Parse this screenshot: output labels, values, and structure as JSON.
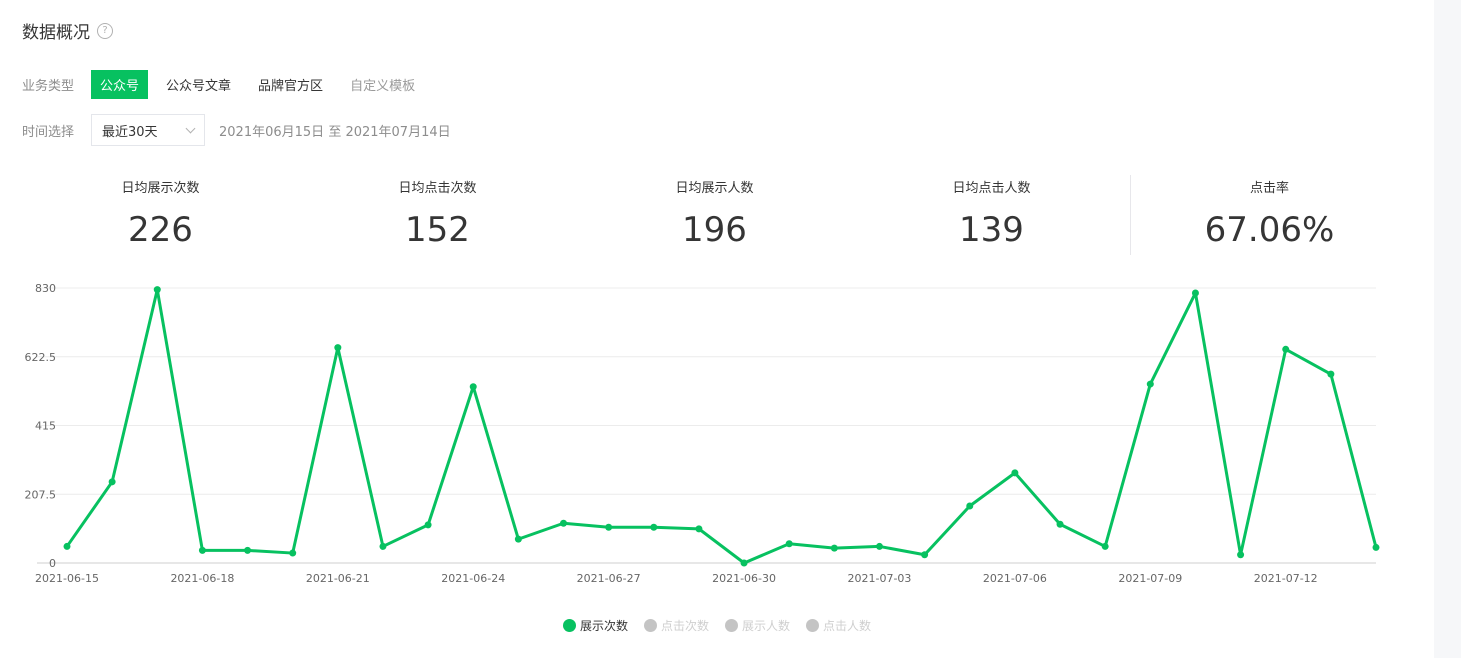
{
  "header": {
    "title": "数据概况",
    "help_glyph": "?"
  },
  "filters": {
    "type_label": "业务类型",
    "types": [
      {
        "label": "公众号",
        "state": "selected"
      },
      {
        "label": "公众号文章",
        "state": "normal"
      },
      {
        "label": "品牌官方区",
        "state": "normal"
      },
      {
        "label": "自定义模板",
        "state": "disabled"
      }
    ],
    "time_label": "时间选择",
    "time_value": "最近30天",
    "date_range": "2021年06月15日 至 2021年07月14日"
  },
  "metrics": [
    {
      "label": "日均展示次数",
      "value": "226"
    },
    {
      "label": "日均点击次数",
      "value": "152"
    },
    {
      "label": "日均展示人数",
      "value": "196"
    },
    {
      "label": "日均点击人数",
      "value": "139"
    },
    {
      "label": "点击率",
      "value": "67.06%"
    }
  ],
  "colors": {
    "accent": "#07c160",
    "legend_inactive": "#c4c4c4",
    "gridline": "#ececec"
  },
  "chart_data": {
    "type": "line",
    "x": [
      "2021-06-15",
      "2021-06-16",
      "2021-06-17",
      "2021-06-18",
      "2021-06-19",
      "2021-06-20",
      "2021-06-21",
      "2021-06-22",
      "2021-06-23",
      "2021-06-24",
      "2021-06-25",
      "2021-06-26",
      "2021-06-27",
      "2021-06-28",
      "2021-06-29",
      "2021-06-30",
      "2021-07-01",
      "2021-07-02",
      "2021-07-03",
      "2021-07-04",
      "2021-07-05",
      "2021-07-06",
      "2021-07-07",
      "2021-07-08",
      "2021-07-09",
      "2021-07-10",
      "2021-07-11",
      "2021-07-12",
      "2021-07-13",
      "2021-07-14"
    ],
    "x_tick_labels": [
      "2021-06-15",
      "2021-06-18",
      "2021-06-21",
      "2021-06-24",
      "2021-06-27",
      "2021-06-30",
      "2021-07-03",
      "2021-07-06",
      "2021-07-09",
      "2021-07-12"
    ],
    "y_tick_labels": [
      "830",
      "622.5",
      "415",
      "207.5",
      "0"
    ],
    "ylim": [
      0,
      830
    ],
    "grid": true,
    "legend_position": "bottom-center",
    "series": [
      {
        "name": "展示次数",
        "active": true,
        "values": [
          50,
          245,
          825,
          38,
          38,
          30,
          650,
          50,
          115,
          532,
          72,
          120,
          108,
          108,
          103,
          0,
          58,
          45,
          50,
          25,
          172,
          272,
          117,
          50,
          540,
          815,
          25,
          645,
          570,
          47
        ]
      },
      {
        "name": "点击次数",
        "active": false,
        "values": []
      },
      {
        "name": "展示人数",
        "active": false,
        "values": []
      },
      {
        "name": "点击人数",
        "active": false,
        "values": []
      }
    ]
  }
}
